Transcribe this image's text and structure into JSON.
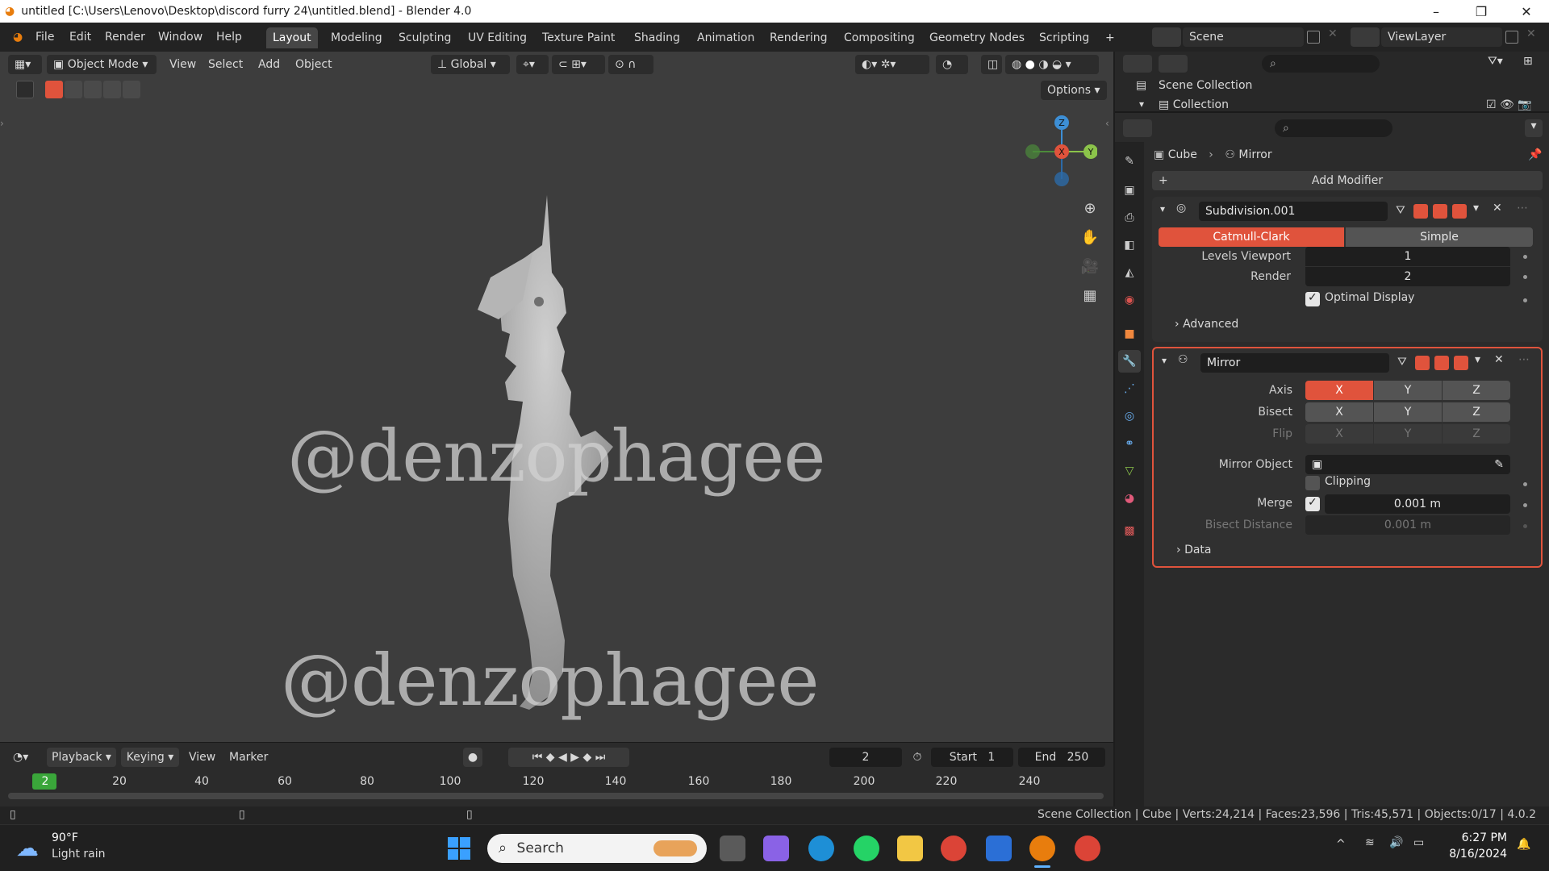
{
  "window": {
    "title": "untitled [C:\\Users\\Lenovo\\Desktop\\discord furry 24\\untitled.blend] - Blender 4.0"
  },
  "menu": [
    "File",
    "Edit",
    "Render",
    "Window",
    "Help"
  ],
  "workspaces": [
    "Layout",
    "Modeling",
    "Sculpting",
    "UV Editing",
    "Texture Paint",
    "Shading",
    "Animation",
    "Rendering",
    "Compositing",
    "Geometry Nodes",
    "Scripting"
  ],
  "active_workspace": "Layout",
  "scene": {
    "label": "Scene",
    "view_layer": "ViewLayer"
  },
  "outliner": {
    "scene_collection": "Scene Collection",
    "collection": "Collection"
  },
  "viewport": {
    "mode": "Object Mode",
    "menus": [
      "View",
      "Select",
      "Add",
      "Object"
    ],
    "transform_orientation": "Global",
    "options_label": "Options",
    "watermark_1": "@denzophagee",
    "watermark_2": "@denzophagee",
    "gizmo": {
      "x": "X",
      "y": "Y",
      "z": "Z"
    }
  },
  "timeline": {
    "playback": "Playback",
    "keying": "Keying",
    "view": "View",
    "marker": "Marker",
    "current_frame": "2",
    "start_label": "Start",
    "start": "1",
    "end_label": "End",
    "end": "250",
    "ticks": [
      "2",
      "20",
      "40",
      "60",
      "80",
      "100",
      "120",
      "140",
      "160",
      "180",
      "200",
      "220",
      "240"
    ]
  },
  "properties": {
    "breadcrumb_object": "Cube",
    "breadcrumb_modifier": "Mirror",
    "add_modifier": "Add Modifier",
    "subdivision": {
      "name": "Subdivision.001",
      "type_catmull": "Catmull-Clark",
      "type_simple": "Simple",
      "levels_viewport_label": "Levels Viewport",
      "levels_viewport": "1",
      "render_label": "Render",
      "render": "2",
      "optimal_display": "Optimal Display",
      "advanced": "Advanced"
    },
    "mirror": {
      "name": "Mirror",
      "axis_label": "Axis",
      "bisect_label": "Bisect",
      "flip_label": "Flip",
      "x": "X",
      "y": "Y",
      "z": "Z",
      "mirror_object_label": "Mirror Object",
      "clipping": "Clipping",
      "merge_label": "Merge",
      "merge": "0.001 m",
      "bisect_distance_label": "Bisect Distance",
      "bisect_distance": "0.001 m",
      "data": "Data"
    }
  },
  "statusbar": {
    "text": "Scene Collection | Cube | Verts:24,214 | Faces:23,596 | Tris:45,571 | Objects:0/17 | 4.0.2"
  },
  "taskbar": {
    "weather_temp": "90°F",
    "weather_desc": "Light rain",
    "search": "Search",
    "time": "6:27 PM",
    "date": "8/16/2024"
  },
  "colors": {
    "accent": "#e0533c",
    "x_axis": "#e0533c",
    "y_axis": "#8bc34a",
    "z_axis": "#3d8fd6"
  }
}
